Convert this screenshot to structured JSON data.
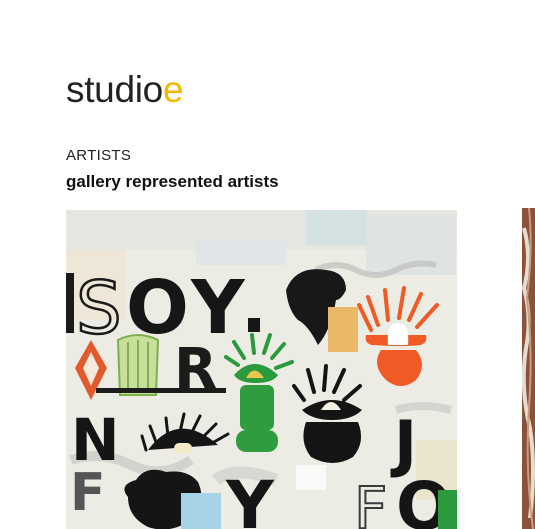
{
  "brand": {
    "name_main": "studio",
    "name_accent": "e",
    "accent_color": "#f5b800"
  },
  "section": {
    "label": "ARTISTS",
    "title": "gallery represented artists"
  },
  "artworks": [
    {
      "kind": "painting",
      "letters": [
        "SOY.",
        "R",
        "N",
        "J",
        "F",
        "Y",
        "FO"
      ]
    },
    {
      "kind": "painting-partial"
    }
  ]
}
